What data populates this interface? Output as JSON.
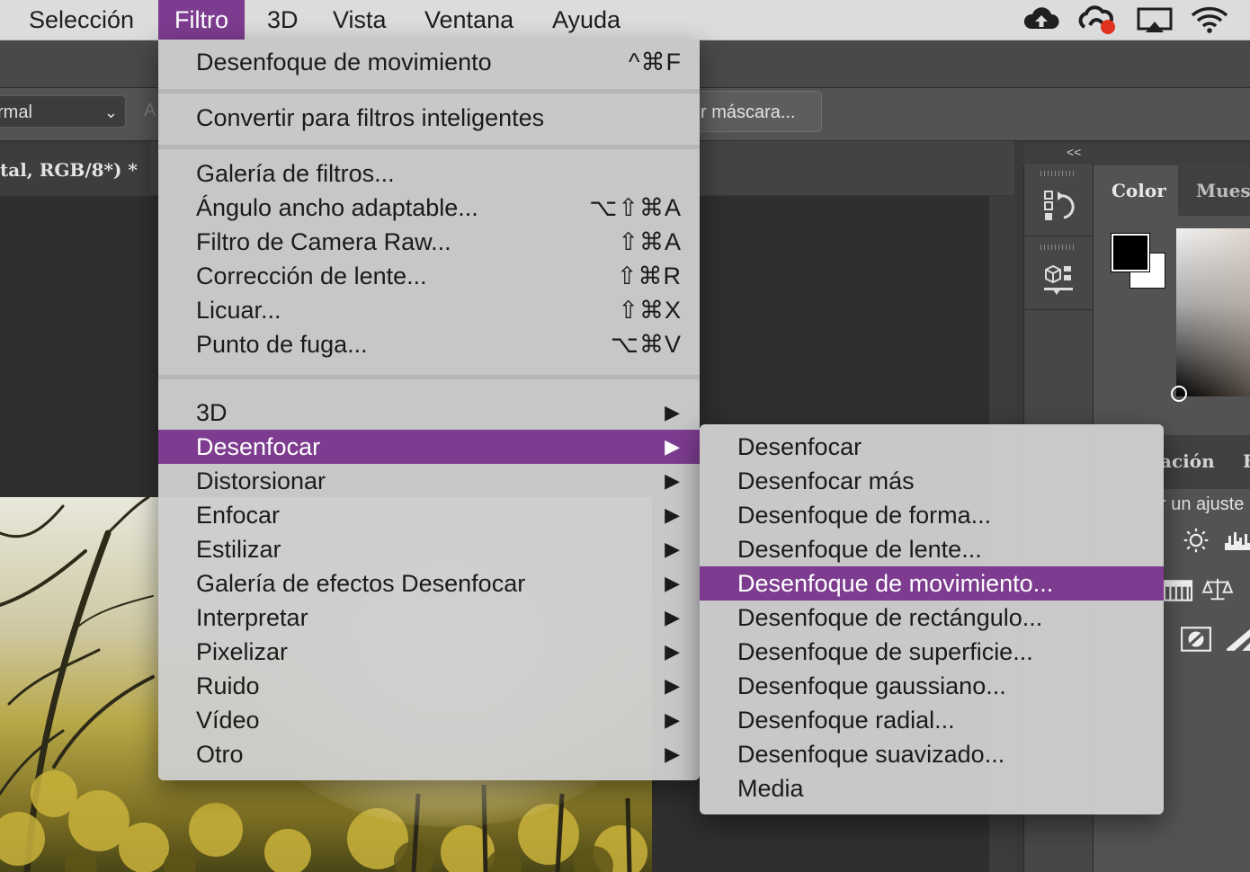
{
  "menubar": {
    "items": [
      "Selección",
      "Filtro",
      "3D",
      "Vista",
      "Ventana",
      "Ayuda"
    ],
    "active": "Filtro"
  },
  "tray_icons": [
    "cloud-upload-icon",
    "creative-cloud-icon",
    "airplay-icon",
    "wifi-icon"
  ],
  "options_bar": {
    "blend_mode": "rmal",
    "faint_label": "A",
    "mask_button": "r máscara..."
  },
  "document": {
    "tab_title": "tal, RGB/8*) *"
  },
  "panels": {
    "collapse_label": "<<",
    "color_tab": "Color",
    "swatches_tab": "Muest",
    "adjust_tab": "ación",
    "adjust_tab2": "E",
    "adjust_hint": "r un ajuste"
  },
  "filter_menu": {
    "last_filter": {
      "label": "Desenfoque de movimiento",
      "shortcut": "^⌘F"
    },
    "convert_smart": {
      "label": "Convertir para filtros inteligentes"
    },
    "group_filters": [
      {
        "label": "Galería de filtros...",
        "shortcut": ""
      },
      {
        "label": "Ángulo ancho adaptable...",
        "shortcut": "⌥⇧⌘A"
      },
      {
        "label": "Filtro de Camera Raw...",
        "shortcut": "⇧⌘A"
      },
      {
        "label": "Corrección de lente...",
        "shortcut": "⇧⌘R"
      },
      {
        "label": "Licuar...",
        "shortcut": "⇧⌘X"
      },
      {
        "label": "Punto de fuga...",
        "shortcut": "⌥⌘V"
      }
    ],
    "categories": [
      {
        "label": "3D"
      },
      {
        "label": "Desenfocar"
      },
      {
        "label": "Distorsionar"
      },
      {
        "label": "Enfocar"
      },
      {
        "label": "Estilizar"
      },
      {
        "label": "Galería de efectos Desenfocar"
      },
      {
        "label": "Interpretar"
      },
      {
        "label": "Pixelizar"
      },
      {
        "label": "Ruido"
      },
      {
        "label": "Vídeo"
      },
      {
        "label": "Otro"
      }
    ],
    "submenu_arrow": "▶",
    "highlighted": "Desenfocar"
  },
  "blur_submenu": {
    "items": [
      "Desenfocar",
      "Desenfocar más",
      "Desenfoque de forma...",
      "Desenfoque de lente...",
      "Desenfoque de movimiento...",
      "Desenfoque de rectángulo...",
      "Desenfoque de superficie...",
      "Desenfoque gaussiano...",
      "Desenfoque radial...",
      "Desenfoque suavizado...",
      "Media"
    ],
    "highlighted": "Desenfoque de movimiento..."
  },
  "colors": {
    "highlight": "#7d3c8f",
    "menu_bg": "#cdcdcd",
    "foreground_color": "#000000",
    "background_color": "#ffffff"
  }
}
